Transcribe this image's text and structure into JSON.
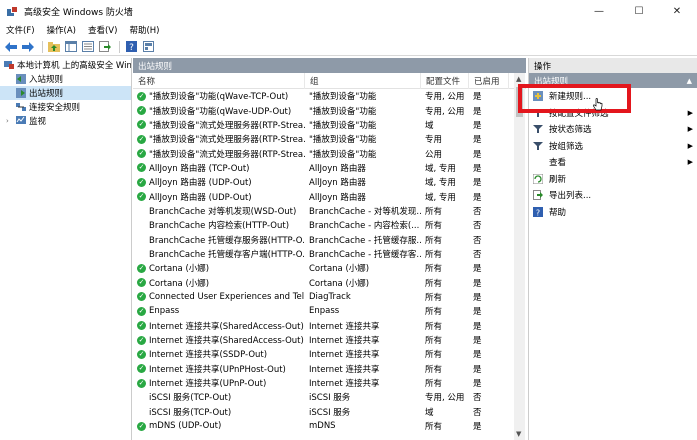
{
  "window": {
    "title": "高级安全 Windows 防火墙",
    "controls": [
      "—",
      "☐",
      "✕"
    ]
  },
  "menu": [
    "文件(F)",
    "操作(A)",
    "查看(V)",
    "帮助(H)"
  ],
  "tree": {
    "root": "本地计算机 上的高级安全 Windows",
    "items": [
      "入站规则",
      "出站规则",
      "连接安全规则",
      "监视"
    ]
  },
  "center": {
    "header": "出站规则",
    "columns": [
      "名称",
      "组",
      "配置文件",
      "已启用"
    ],
    "rows": [
      {
        "enabled_icon": true,
        "name": "\"播放到设备\"功能(qWave-TCP-Out)",
        "group": "\"播放到设备\"功能",
        "profile": "专用, 公用",
        "enabled": "是"
      },
      {
        "enabled_icon": true,
        "name": "\"播放到设备\"功能(qWave-UDP-Out)",
        "group": "\"播放到设备\"功能",
        "profile": "专用, 公用",
        "enabled": "是"
      },
      {
        "enabled_icon": true,
        "name": "\"播放到设备\"流式处理服务器(RTP-Strea...",
        "group": "\"播放到设备\"功能",
        "profile": "域",
        "enabled": "是"
      },
      {
        "enabled_icon": true,
        "name": "\"播放到设备\"流式处理服务器(RTP-Strea...",
        "group": "\"播放到设备\"功能",
        "profile": "专用",
        "enabled": "是"
      },
      {
        "enabled_icon": true,
        "name": "\"播放到设备\"流式处理服务器(RTP-Strea...",
        "group": "\"播放到设备\"功能",
        "profile": "公用",
        "enabled": "是"
      },
      {
        "enabled_icon": true,
        "name": "AllJoyn 路由器 (TCP-Out)",
        "group": "AllJoyn 路由器",
        "profile": "域, 专用",
        "enabled": "是"
      },
      {
        "enabled_icon": true,
        "name": "AllJoyn 路由器 (UDP-Out)",
        "group": "AllJoyn 路由器",
        "profile": "域, 专用",
        "enabled": "是"
      },
      {
        "enabled_icon": true,
        "name": "AllJoyn 路由器 (UDP-Out)",
        "group": "AllJoyn 路由器",
        "profile": "域, 专用",
        "enabled": "是"
      },
      {
        "enabled_icon": false,
        "name": "BranchCache 对等机发现(WSD-Out)",
        "group": "BranchCache - 对等机发现...",
        "profile": "所有",
        "enabled": "否"
      },
      {
        "enabled_icon": false,
        "name": "BranchCache 内容检索(HTTP-Out)",
        "group": "BranchCache - 内容检索(...",
        "profile": "所有",
        "enabled": "否"
      },
      {
        "enabled_icon": false,
        "name": "BranchCache 托管缓存服务器(HTTP-O...",
        "group": "BranchCache - 托管缓存服...",
        "profile": "所有",
        "enabled": "否"
      },
      {
        "enabled_icon": false,
        "name": "BranchCache 托管缓存客户端(HTTP-O...",
        "group": "BranchCache - 托管缓存客...",
        "profile": "所有",
        "enabled": "否"
      },
      {
        "enabled_icon": true,
        "name": "Cortana (小娜)",
        "group": "Cortana (小娜)",
        "profile": "所有",
        "enabled": "是"
      },
      {
        "enabled_icon": true,
        "name": "Cortana (小娜)",
        "group": "Cortana (小娜)",
        "profile": "所有",
        "enabled": "是"
      },
      {
        "enabled_icon": true,
        "name": "Connected User Experiences and Tel...",
        "group": "DiagTrack",
        "profile": "所有",
        "enabled": "是"
      },
      {
        "enabled_icon": true,
        "name": "Enpass",
        "group": "Enpass",
        "profile": "所有",
        "enabled": "是"
      },
      {
        "enabled_icon": true,
        "name": "Internet 连接共享(SharedAccess-Out)",
        "group": "Internet 连接共享",
        "profile": "所有",
        "enabled": "是"
      },
      {
        "enabled_icon": true,
        "name": "Internet 连接共享(SharedAccess-Out)",
        "group": "Internet 连接共享",
        "profile": "所有",
        "enabled": "是"
      },
      {
        "enabled_icon": true,
        "name": "Internet 连接共享(SSDP-Out)",
        "group": "Internet 连接共享",
        "profile": "所有",
        "enabled": "是"
      },
      {
        "enabled_icon": true,
        "name": "Internet 连接共享(UPnPHost-Out)",
        "group": "Internet 连接共享",
        "profile": "所有",
        "enabled": "是"
      },
      {
        "enabled_icon": true,
        "name": "Internet 连接共享(UPnP-Out)",
        "group": "Internet 连接共享",
        "profile": "所有",
        "enabled": "是"
      },
      {
        "enabled_icon": false,
        "name": "iSCSI 服务(TCP-Out)",
        "group": "iSCSI 服务",
        "profile": "专用, 公用",
        "enabled": "否"
      },
      {
        "enabled_icon": false,
        "name": "iSCSI 服务(TCP-Out)",
        "group": "iSCSI 服务",
        "profile": "域",
        "enabled": "否"
      },
      {
        "enabled_icon": true,
        "name": "mDNS (UDP-Out)",
        "group": "mDNS",
        "profile": "所有",
        "enabled": "是"
      }
    ]
  },
  "actions": {
    "header": "操作",
    "subheader": "出站规则",
    "items": [
      {
        "label": "新建规则...",
        "icon": "new-rule-icon",
        "submenu": false
      },
      {
        "label": "按配置文件筛选",
        "icon": "filter-icon",
        "submenu": true
      },
      {
        "label": "按状态筛选",
        "icon": "filter-icon",
        "submenu": true
      },
      {
        "label": "按组筛选",
        "icon": "filter-icon",
        "submenu": true
      },
      {
        "label": "查看",
        "icon": "",
        "submenu": true
      },
      {
        "label": "刷新",
        "icon": "refresh-icon",
        "submenu": false
      },
      {
        "label": "导出列表...",
        "icon": "export-icon",
        "submenu": false
      },
      {
        "label": "帮助",
        "icon": "help-icon",
        "submenu": false
      }
    ]
  },
  "colors": {
    "header_bg": "#8e9aa8",
    "highlight": "#e3161d",
    "enabled_green": "#29a843",
    "selected": "#cce4f7"
  }
}
